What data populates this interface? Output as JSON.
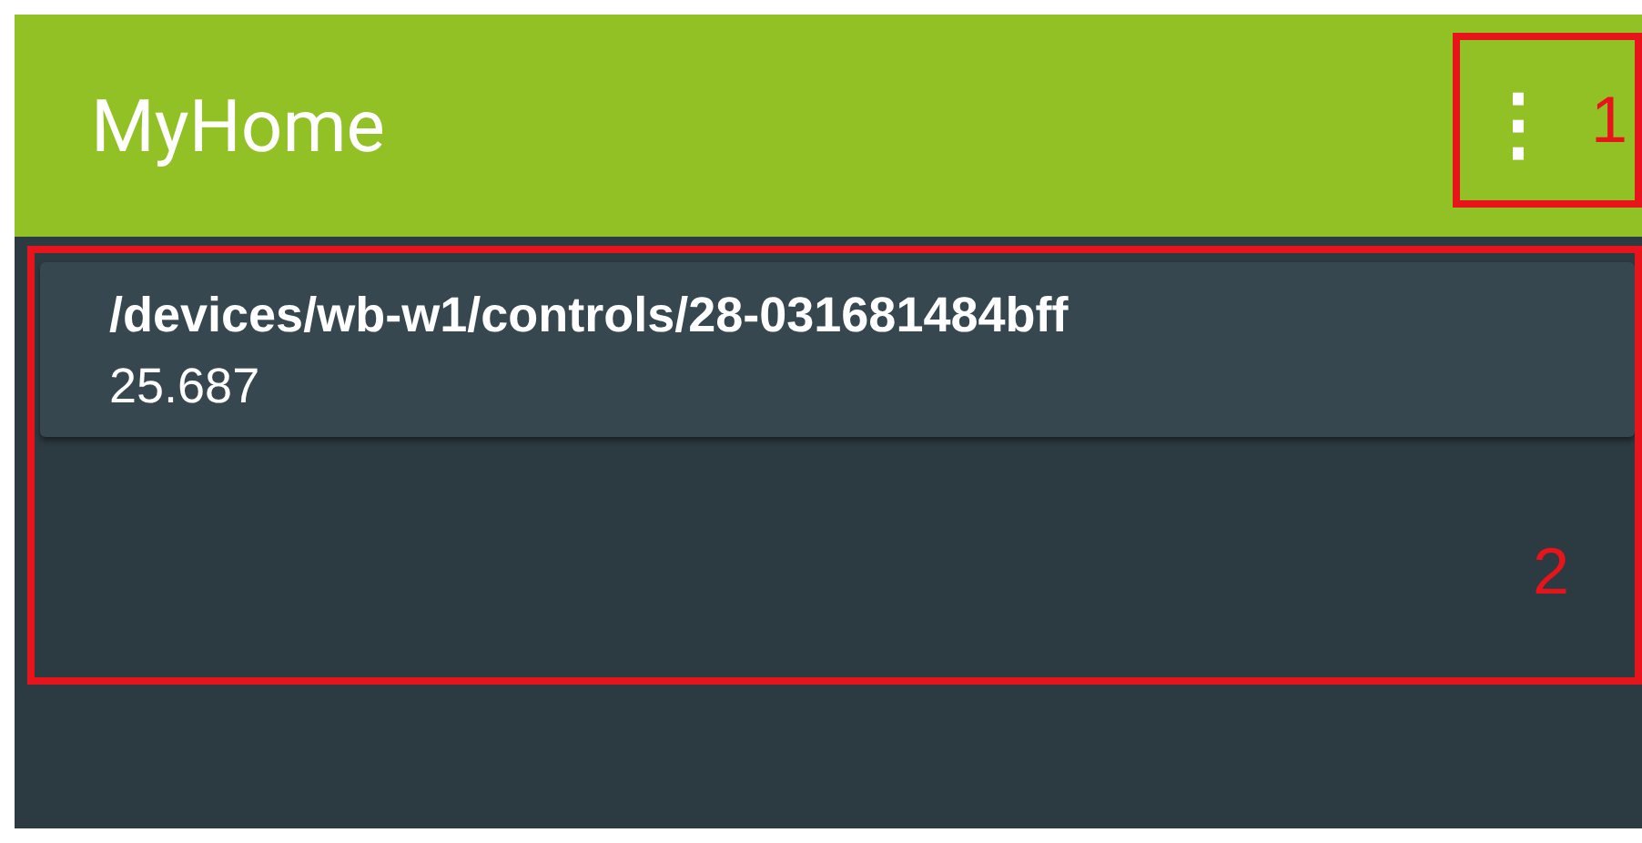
{
  "app_bar": {
    "title": "MyHome",
    "menu_icon": "⋮"
  },
  "cards": [
    {
      "path": "/devices/wb-w1/controls/28-031681484bff",
      "value": "25.687"
    }
  ],
  "annotations": [
    {
      "label": "1",
      "kind": "menu"
    },
    {
      "label": "2",
      "kind": "content"
    }
  ]
}
